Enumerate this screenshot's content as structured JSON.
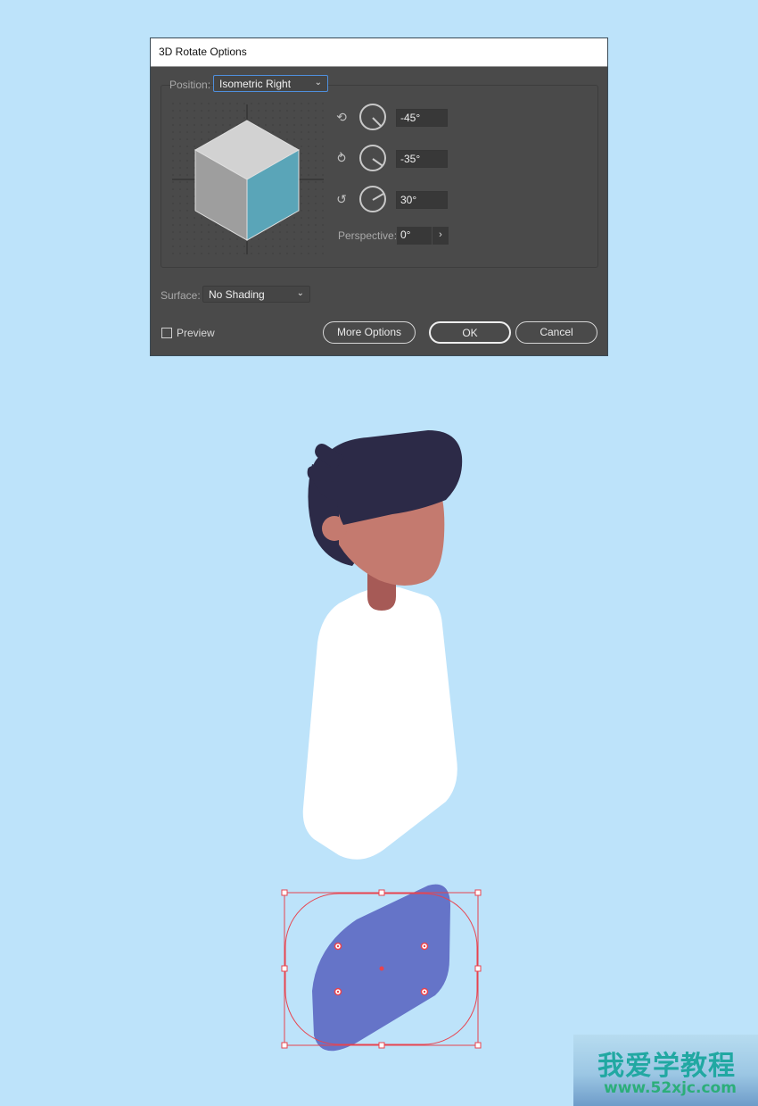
{
  "dialog": {
    "title": "3D Rotate Options",
    "position": {
      "label": "Position:",
      "value": "Isometric Right"
    },
    "rotations": [
      {
        "axis": "x-axis",
        "value": "-45°",
        "angle_deg": -45
      },
      {
        "axis": "y-axis",
        "value": "-35°",
        "angle_deg": -35
      },
      {
        "axis": "z-axis",
        "value": "30°",
        "angle_deg": 30
      }
    ],
    "perspective": {
      "label": "Perspective:",
      "value": "0°",
      "button": "›"
    },
    "surface": {
      "label": "Surface:",
      "value": "No Shading"
    },
    "preview": {
      "label": "Preview",
      "checked": false
    },
    "buttons": {
      "more_options": "More Options",
      "ok": "OK",
      "cancel": "Cancel"
    },
    "chevron": "⌄",
    "cube_colors": {
      "top": "#d2d2d2",
      "left": "#9e9e9e",
      "right": "#5aa5b8"
    }
  },
  "illustration": {
    "colors": {
      "background": "#bde3fa",
      "hair": "#2c2a47",
      "skin": "#c47a6f",
      "neck": "#a65a56",
      "shirt": "#ffffff",
      "shape": "#6574c8",
      "selection": "#e8434e"
    }
  },
  "watermark": {
    "chinese": "我爱学教程",
    "url": "www.52xjc.com"
  }
}
